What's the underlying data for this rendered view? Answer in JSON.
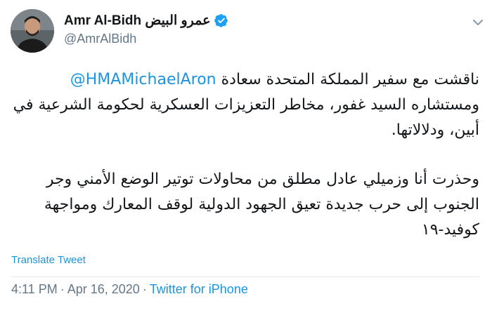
{
  "author": {
    "name": "Amr Al-Bidh عمرو البيض",
    "handle": "@AmrAlBidh",
    "verified": true
  },
  "tweet": {
    "line1_text": "ناقشت مع سفير المملكة المتحدة سعادة ",
    "mention": "@HMAMichaelAron",
    "line1_rest": "ومستشاره السيد غفور، مخاطر التعزيزات العسكرية لحكومة الشرعية في أبين، ودلالاتها.",
    "paragraph2": "وحذرت أنا وزميلي عادل مطلق من محاولات توتير الوضع الأمني وجر الجنوب إلى حرب جديدة تعيق الجهود الدولية لوقف المعارك ومواجهة كوفيد-١٩"
  },
  "translate_label": "Translate Tweet",
  "meta": {
    "time": "4:11 PM",
    "separator": "·",
    "date": "Apr 16, 2020",
    "source": "Twitter for iPhone"
  },
  "colors": {
    "link": "#1b95e0",
    "muted": "#657786",
    "text": "#14171a"
  },
  "icons": {
    "verified": "verified-badge-icon",
    "menu": "chevron-down-icon"
  }
}
